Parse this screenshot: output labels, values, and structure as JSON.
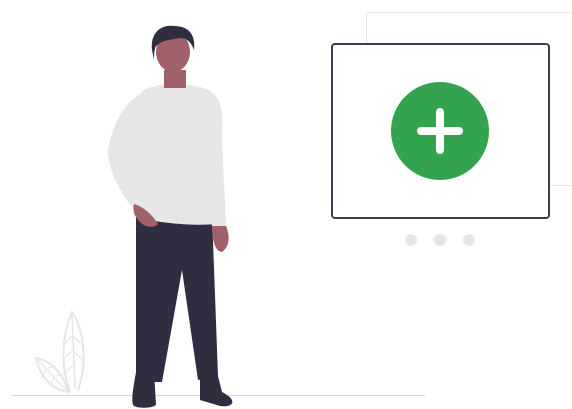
{
  "scene": {
    "action_icon": "plus-icon",
    "colors": {
      "accent_green": "#34a350",
      "card_border": "#3f3d56",
      "back_card_border": "#e6e6e6",
      "dot_color": "#e6e6e6",
      "skin": "#a0616a",
      "shirt": "#e6e6e6",
      "pants": "#2f2e41",
      "hair": "#2f2e41"
    },
    "pagination": {
      "dot_count": 3
    }
  }
}
